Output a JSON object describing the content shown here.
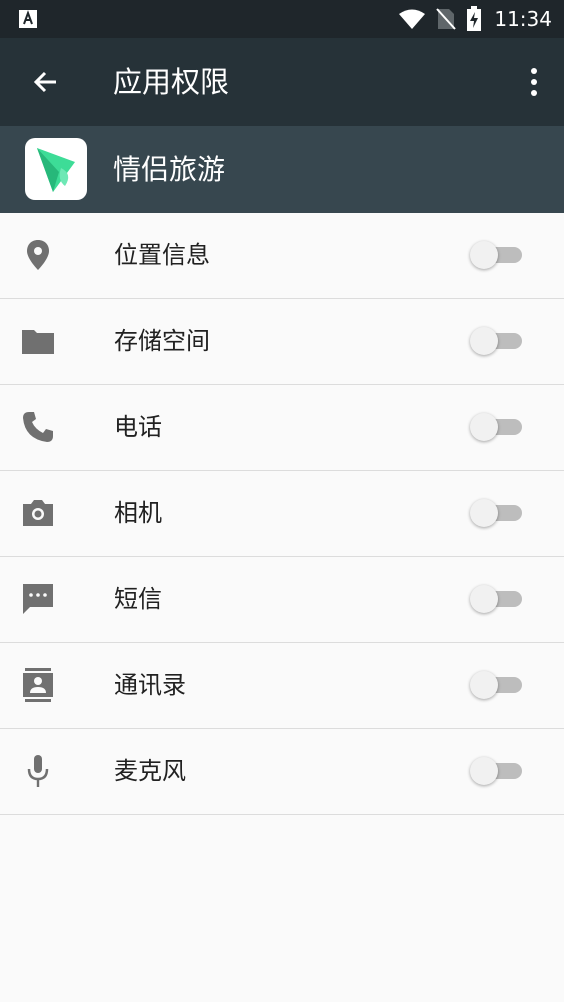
{
  "status_bar": {
    "time": "11:34",
    "icons": [
      "notification-a-icon",
      "wifi-icon",
      "no-sim-icon",
      "battery-charging-icon"
    ]
  },
  "toolbar": {
    "title": "应用权限",
    "icons": [
      "back-arrow-icon",
      "more-vert-icon"
    ]
  },
  "app": {
    "name": "情侣旅游",
    "icon": "paper-plane-leaf-app-icon"
  },
  "permissions": [
    {
      "label": "位置信息",
      "icon": "location-pin-icon",
      "enabled": false
    },
    {
      "label": "存储空间",
      "icon": "folder-icon",
      "enabled": false
    },
    {
      "label": "电话",
      "icon": "phone-icon",
      "enabled": false
    },
    {
      "label": "相机",
      "icon": "camera-icon",
      "enabled": false
    },
    {
      "label": "短信",
      "icon": "sms-icon",
      "enabled": false
    },
    {
      "label": "通讯录",
      "icon": "contacts-icon",
      "enabled": false
    },
    {
      "label": "麦克风",
      "icon": "microphone-icon",
      "enabled": false
    }
  ],
  "colors": {
    "status_bar": "#1f262b",
    "toolbar": "#263238",
    "app_header": "#37474f",
    "background": "#fafafa",
    "icon_gray": "#707070",
    "app_icon_green": "#3ddc97"
  }
}
